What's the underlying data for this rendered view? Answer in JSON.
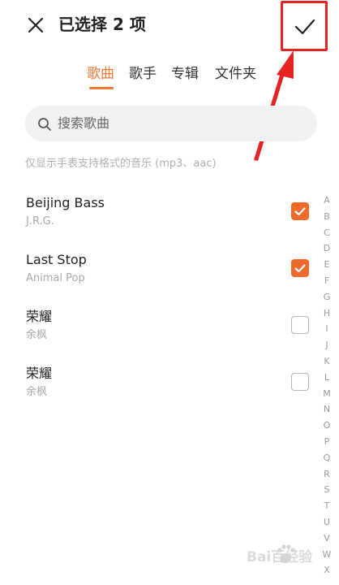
{
  "header": {
    "title": "已选择 2 项",
    "close_icon": "close-icon",
    "confirm_icon": "checkmark-icon"
  },
  "tabs": [
    {
      "label": "歌曲",
      "active": true
    },
    {
      "label": "歌手",
      "active": false
    },
    {
      "label": "专辑",
      "active": false
    },
    {
      "label": "文件夹",
      "active": false
    }
  ],
  "search": {
    "placeholder": "搜索歌曲",
    "icon": "search-icon"
  },
  "hint": "仅显示手表支持格式的音乐 (mp3、aac)",
  "songs": [
    {
      "title": "Beijing Bass",
      "artist": "J.R.G.",
      "checked": true
    },
    {
      "title": "Last Stop",
      "artist": "Animal Pop",
      "checked": true
    },
    {
      "title": "荣耀",
      "artist": "余枫",
      "checked": false
    },
    {
      "title": "荣耀",
      "artist": "余枫",
      "checked": false
    }
  ],
  "alphabet": [
    "A",
    "B",
    "C",
    "D",
    "E",
    "F",
    "G",
    "H",
    "I",
    "J",
    "K",
    "L",
    "M",
    "N",
    "O",
    "P",
    "Q",
    "R",
    "S",
    "T",
    "U",
    "V",
    "W",
    "X"
  ],
  "colors": {
    "accent": "#ee7a35",
    "checkbox_on": "#ee6a2b",
    "annotation": "#e52323"
  },
  "watermark": {
    "text": "Bai百经验",
    "icon": "paw-icon"
  }
}
